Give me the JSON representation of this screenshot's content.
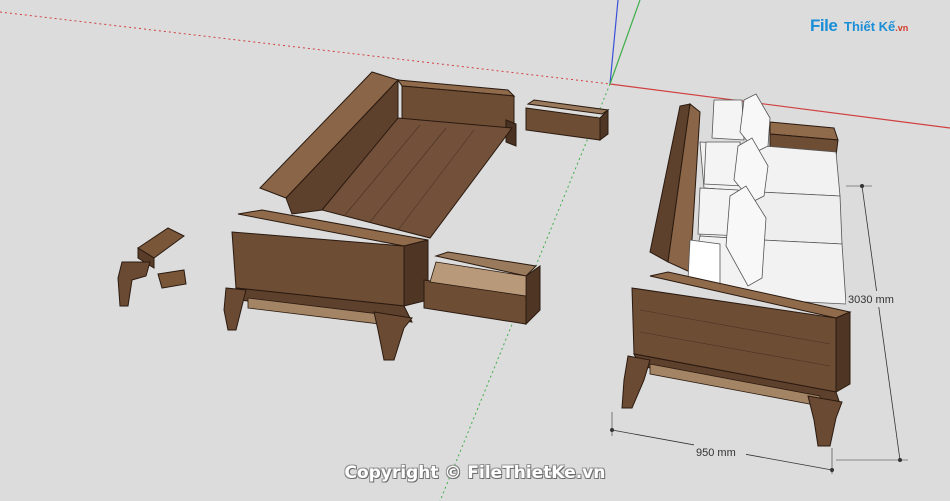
{
  "logo": {
    "brand": "File",
    "name": "Thiết Kế",
    "tld": ".vn"
  },
  "dimensions": {
    "length_label": "3030 mm",
    "width_label": "950 mm"
  },
  "watermark": {
    "text": "Copyright © FileThietKe.vn"
  },
  "colors": {
    "background": "#dcdcdc",
    "wood_light": "#8a6547",
    "wood_mid": "#6b4a33",
    "wood_dark": "#4a3222",
    "cushion": "#f2f2f2",
    "axis_red": "#d04040",
    "axis_green": "#3fae4a",
    "axis_blue": "#3a4fd8"
  }
}
